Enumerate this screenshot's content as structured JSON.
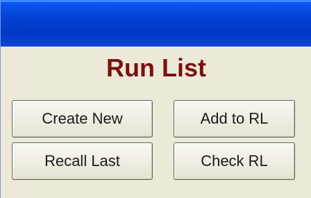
{
  "panel": {
    "heading": "Run List"
  },
  "buttons": {
    "create_new": "Create New",
    "add_to_rl": "Add to RL",
    "recall_last": "Recall Last",
    "check_rl": "Check RL"
  },
  "colors": {
    "titlebar": "#0443d6",
    "panel_background": "#ece9d8",
    "heading_text": "#7a1010",
    "button_face": "#f1efe5",
    "button_border": "#5f5f5f"
  }
}
